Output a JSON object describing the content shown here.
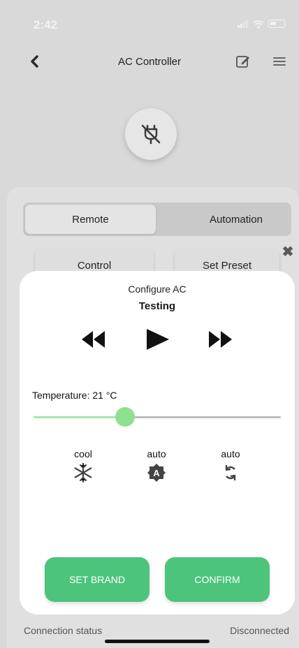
{
  "status_bar": {
    "time": "2:42"
  },
  "header": {
    "title": "AC Controller"
  },
  "tabs": {
    "remote": "Remote",
    "automation": "Automation"
  },
  "subtabs": {
    "control": "Control",
    "set_preset": "Set Preset"
  },
  "dialog": {
    "heading": "Configure AC",
    "device_name": "Testing",
    "temperature_label": "Temperature: 21 °C",
    "temperature_level": 0.37,
    "modes": [
      {
        "label": "cool",
        "icon": "snowflake-icon"
      },
      {
        "label": "auto",
        "icon": "auto-fan-icon"
      },
      {
        "label": "auto",
        "icon": "swing-icon"
      }
    ],
    "buttons": {
      "set_brand": "SET BRAND",
      "confirm": "CONFIRM"
    }
  },
  "footer": {
    "connection_label": "Connection status",
    "connection_value": "Disconnected"
  },
  "colors": {
    "accent": "#4cc47c",
    "slider": "#8fe08f"
  }
}
